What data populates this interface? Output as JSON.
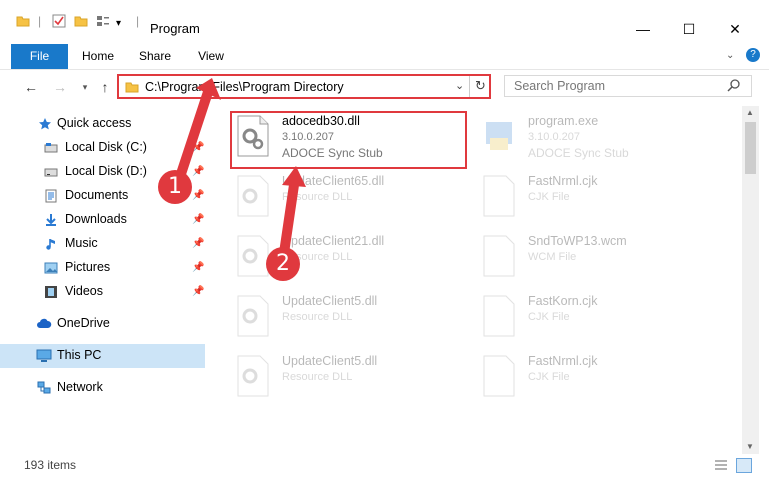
{
  "window": {
    "title": "Program",
    "minimize": "—",
    "maximize": "☐",
    "close": "✕"
  },
  "ribbon": {
    "tabs": [
      "File",
      "Home",
      "Share",
      "View"
    ],
    "help": "?"
  },
  "address_bar": {
    "path": "C:\\Program Files\\Program Directory",
    "search_placeholder": "Search Program"
  },
  "sidebar": {
    "items": [
      {
        "label": "Quick access",
        "icon": "star-icon"
      },
      {
        "label": "Local Disk (C:)",
        "icon": "drive-icon",
        "pinned": true
      },
      {
        "label": "Local Disk (D:)",
        "icon": "drive-icon",
        "pinned": true
      },
      {
        "label": "Documents",
        "icon": "documents-icon",
        "pinned": true
      },
      {
        "label": "Downloads",
        "icon": "download-icon",
        "pinned": true
      },
      {
        "label": "Music",
        "icon": "music-icon",
        "pinned": true
      },
      {
        "label": "Pictures",
        "icon": "pictures-icon",
        "pinned": true
      },
      {
        "label": "Videos",
        "icon": "videos-icon",
        "pinned": true
      },
      {
        "label": "OneDrive",
        "icon": "cloud-icon"
      },
      {
        "label": "This PC",
        "icon": "computer-icon",
        "selected": true
      },
      {
        "label": "Network",
        "icon": "network-icon"
      }
    ]
  },
  "files": [
    {
      "name": "adocedb30.dll",
      "version": "3.10.0.207",
      "type": "ADOCE Sync Stub",
      "selected": true
    },
    {
      "name": "program.exe",
      "version": "3.10.0.207",
      "type": "ADOCE Sync Stub"
    },
    {
      "name": "UpdateClient65.dll",
      "type": "Resource DLL"
    },
    {
      "name": "FastNrml.cjk",
      "type": "CJK File"
    },
    {
      "name": "UpdateClient21.dll",
      "type": "Resource DLL"
    },
    {
      "name": "SndToWP13.wcm",
      "type": "WCM File"
    },
    {
      "name": "UpdateClient5.dll",
      "type": "Resource DLL"
    },
    {
      "name": "FastKorn.cjk",
      "type": "CJK File"
    },
    {
      "name": "UpdateClient5.dll",
      "type": "Resource DLL"
    },
    {
      "name": "FastNrml.cjk",
      "type": "CJK File"
    }
  ],
  "status": {
    "count": "193 items"
  },
  "annotations": [
    "1",
    "2"
  ],
  "colors": {
    "accent": "#1979ca",
    "highlight": "#e0393e",
    "selection": "#cce4f7"
  }
}
